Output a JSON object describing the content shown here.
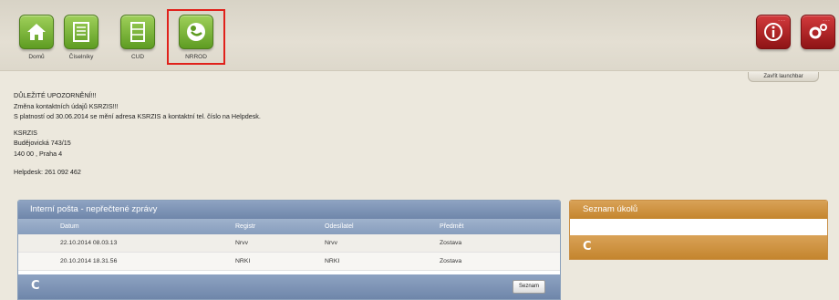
{
  "launchbar": {
    "tiles": [
      {
        "label": "Domů",
        "icon": "home-icon"
      },
      {
        "label": "Číselníky",
        "icon": "book-icon"
      },
      {
        "label": "CUD",
        "icon": "cabinet-icon"
      },
      {
        "label": "NRROD",
        "icon": "mother-child-icon"
      }
    ],
    "close_label": "Zavřít launchbar",
    "info_icon": "info-icon",
    "settings_icon": "gears-icon",
    "dots": "..."
  },
  "notice": {
    "line1": "DŮLEŽITÉ UPOZORNĚNÍ!!!",
    "line2": "Změna kontaktních údajů KSRZIS!!!",
    "line3": "S platností od 30.06.2014 se mění adresa KSRZIS a kontaktní tel. číslo na Helpdesk.",
    "line4": "KSRZIS",
    "line5": "Budějovická 743/15",
    "line6": "140 00 , Praha 4",
    "line7": "Helpdesk: 261 092 462"
  },
  "mail_panel": {
    "title": "Interní pošta - nepřečtené zprávy",
    "columns": [
      "Datum",
      "Registr",
      "Odesílatel",
      "Předmět"
    ],
    "rows": [
      [
        "22.10.2014 08.03.13",
        "Nrvv",
        "Nrvv",
        "Zostava"
      ],
      [
        "20.10.2014 18.31.56",
        "NRKI",
        "NRKI",
        "Zostava"
      ]
    ],
    "refresh": "C",
    "seznam_button": "Seznam"
  },
  "tasks_panel": {
    "title": "Seznam úkolů",
    "refresh": "C"
  },
  "colors": {
    "accent_green": "#6aa82a",
    "accent_red": "#b0191c",
    "panel_blue": "#7d93b5",
    "panel_orange": "#cf933f",
    "selection_frame": "#e0211b"
  }
}
